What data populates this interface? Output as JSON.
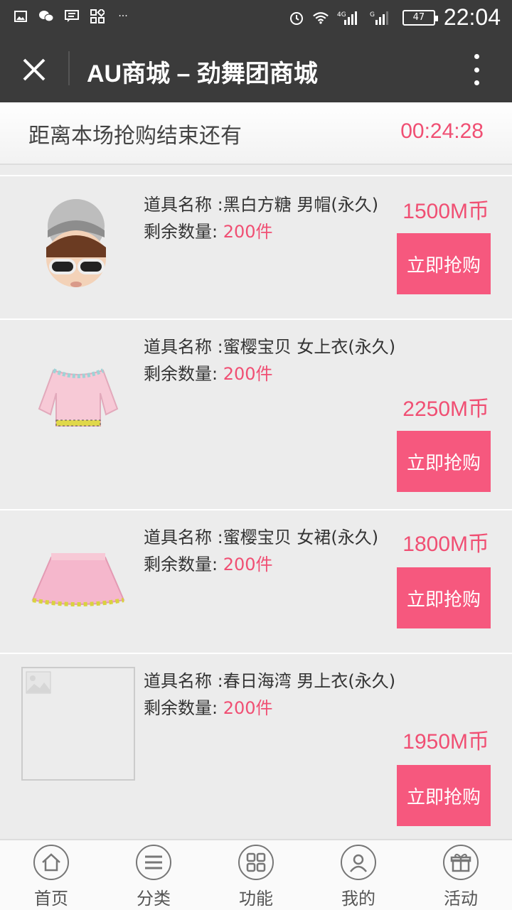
{
  "statusbar": {
    "left_icons": [
      "image-icon",
      "wechat-icon",
      "message-icon",
      "apps-icon",
      "more-dots-icon"
    ],
    "network1": "4G",
    "network2": "G",
    "battery": "47",
    "time": "22:04"
  },
  "titlebar": {
    "title": "AU商城 – 劲舞团商城"
  },
  "countdown": {
    "label": "距离本场抢购结束还有",
    "timer": "00:24:28"
  },
  "items": [
    {
      "name_label": "道具名称 :",
      "name": "黑白方糖 男帽(永久)",
      "qty_label": "剩余数量:",
      "qty": "200件",
      "price": "1500M币",
      "buy": "立即抢购"
    },
    {
      "name_label": "道具名称 :",
      "name": "蜜樱宝贝 女上衣(永久)",
      "qty_label": "剩余数量:",
      "qty": "200件",
      "price": "2250M币",
      "buy": "立即抢购"
    },
    {
      "name_label": "道具名称 :",
      "name": "蜜樱宝贝 女裙(永久)",
      "qty_label": "剩余数量:",
      "qty": "200件",
      "price": "1800M币",
      "buy": "立即抢购"
    },
    {
      "name_label": "道具名称 :",
      "name": "春日海湾 男上衣(永久)",
      "qty_label": "剩余数量:",
      "qty": "200件",
      "price": "1950M币",
      "buy": "立即抢购"
    }
  ],
  "bottom_nav": [
    {
      "label": "首页",
      "icon": "home-icon"
    },
    {
      "label": "分类",
      "icon": "menu-icon"
    },
    {
      "label": "功能",
      "icon": "grid-icon"
    },
    {
      "label": "我的",
      "icon": "user-icon"
    },
    {
      "label": "活动",
      "icon": "gift-icon"
    }
  ],
  "colors": {
    "accent": "#f6587e",
    "price": "#f04f73",
    "header": "#3b3b3b"
  }
}
